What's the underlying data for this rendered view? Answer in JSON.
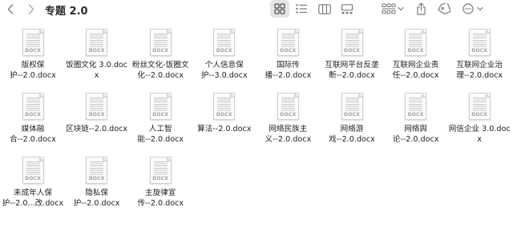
{
  "window": {
    "title": "专题 2.0"
  },
  "toolbar": {
    "back_icon": "chevron-left-icon",
    "forward_icon": "chevron-right-icon",
    "views": [
      "icon-view",
      "list-view",
      "column-view",
      "gallery-view"
    ],
    "active_view": "icon-view",
    "group_icon": "group-by-icon",
    "share_icon": "share-icon",
    "tag_icon": "tag-icon",
    "more_icon": "more-icon"
  },
  "files": [
    {
      "line1": "版权保",
      "line2": "护--2.0.docx",
      "ext": "DOCX"
    },
    {
      "line1": "饭圈文化 3.0.docx",
      "line2": "",
      "ext": "DOCX"
    },
    {
      "line1": "粉丝文化-饭圈文",
      "line2": "化--2.0.docx",
      "ext": "DOCX"
    },
    {
      "line1": "个人信息保",
      "line2": "护--3.0.docx",
      "ext": "DOCX"
    },
    {
      "line1": "国际传",
      "line2": "播--2.0.docx",
      "ext": "DOCX"
    },
    {
      "line1": "互联网平台反垄",
      "line2": "断--2.0.docx",
      "ext": "DOCX"
    },
    {
      "line1": "互联网企业责",
      "line2": "任--2.0.docx",
      "ext": "DOCX"
    },
    {
      "line1": "互联网企业治",
      "line2": "理--2.0.docx",
      "ext": "DOCX"
    },
    {
      "line1": "媒体融",
      "line2": "合--2.0.docx",
      "ext": "DOCX"
    },
    {
      "line1": "区块链--2.0.docx",
      "line2": "",
      "ext": "DOCX"
    },
    {
      "line1": "人工智",
      "line2": "能--2.0.docx",
      "ext": "DOCX"
    },
    {
      "line1": "算法--2.0.docx",
      "line2": "",
      "ext": "DOCX"
    },
    {
      "line1": "网络民族主",
      "line2": "义--2.0.docx",
      "ext": "DOCX"
    },
    {
      "line1": "网络游",
      "line2": "戏--2.0.docx",
      "ext": "DOCX"
    },
    {
      "line1": "网络舆",
      "line2": "论--2.0.docx",
      "ext": "DOCX"
    },
    {
      "line1": "网信企业 3.0.docx",
      "line2": "",
      "ext": "DOCX"
    },
    {
      "line1": "未成年人保",
      "line2": "护--2.0...改.docx",
      "ext": "DOCX"
    },
    {
      "line1": "隐私保",
      "line2": "护--2.0.docx",
      "ext": "DOCX"
    },
    {
      "line1": "主旋律宣",
      "line2": "传--2.0.docx",
      "ext": "DOCX"
    }
  ]
}
